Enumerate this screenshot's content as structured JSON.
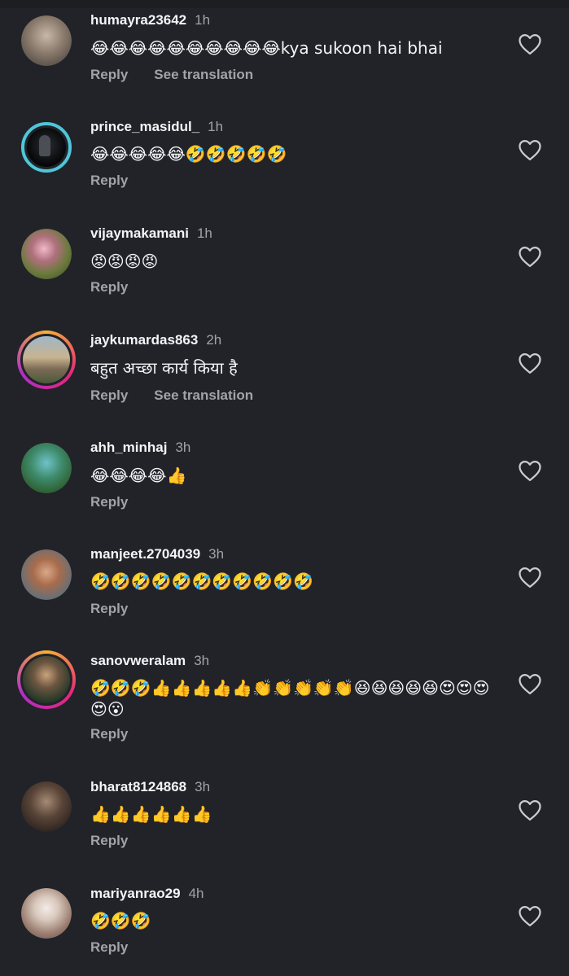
{
  "comments": [
    {
      "username": "humayra23642",
      "time": "1h",
      "text": "😂😂😂😂😂😂😂😂😂😂kya sukoon hai bhai",
      "reply": "Reply",
      "translate": "See translation"
    },
    {
      "username": "prince_masidul_",
      "time": "1h",
      "text": "😂😂😂😂😂🤣🤣🤣🤣🤣",
      "reply": "Reply"
    },
    {
      "username": "vijaymakamani",
      "time": "1h",
      "text": "😡😡😡😡",
      "reply": "Reply"
    },
    {
      "username": "jaykumardas863",
      "time": "2h",
      "text": "बहुत अच्छा कार्य किया है",
      "reply": "Reply",
      "translate": "See translation"
    },
    {
      "username": "ahh_minhaj",
      "time": "3h",
      "text": "😂😂😂😂👍",
      "reply": "Reply"
    },
    {
      "username": "manjeet.2704039",
      "time": "3h",
      "text": "🤣🤣🤣🤣🤣🤣🤣🤣🤣🤣🤣",
      "reply": "Reply"
    },
    {
      "username": "sanovweralam",
      "time": "3h",
      "text": "🤣🤣🤣👍👍👍👍👍👏👏👏👏👏😆😆😆😆😆😍😍😍😍😮",
      "reply": "Reply"
    },
    {
      "username": "bharat8124868",
      "time": "3h",
      "text": "👍👍👍👍👍👍",
      "reply": "Reply"
    },
    {
      "username": "mariyanrao29",
      "time": "4h",
      "text": "🤣🤣🤣",
      "reply": "Reply"
    }
  ]
}
